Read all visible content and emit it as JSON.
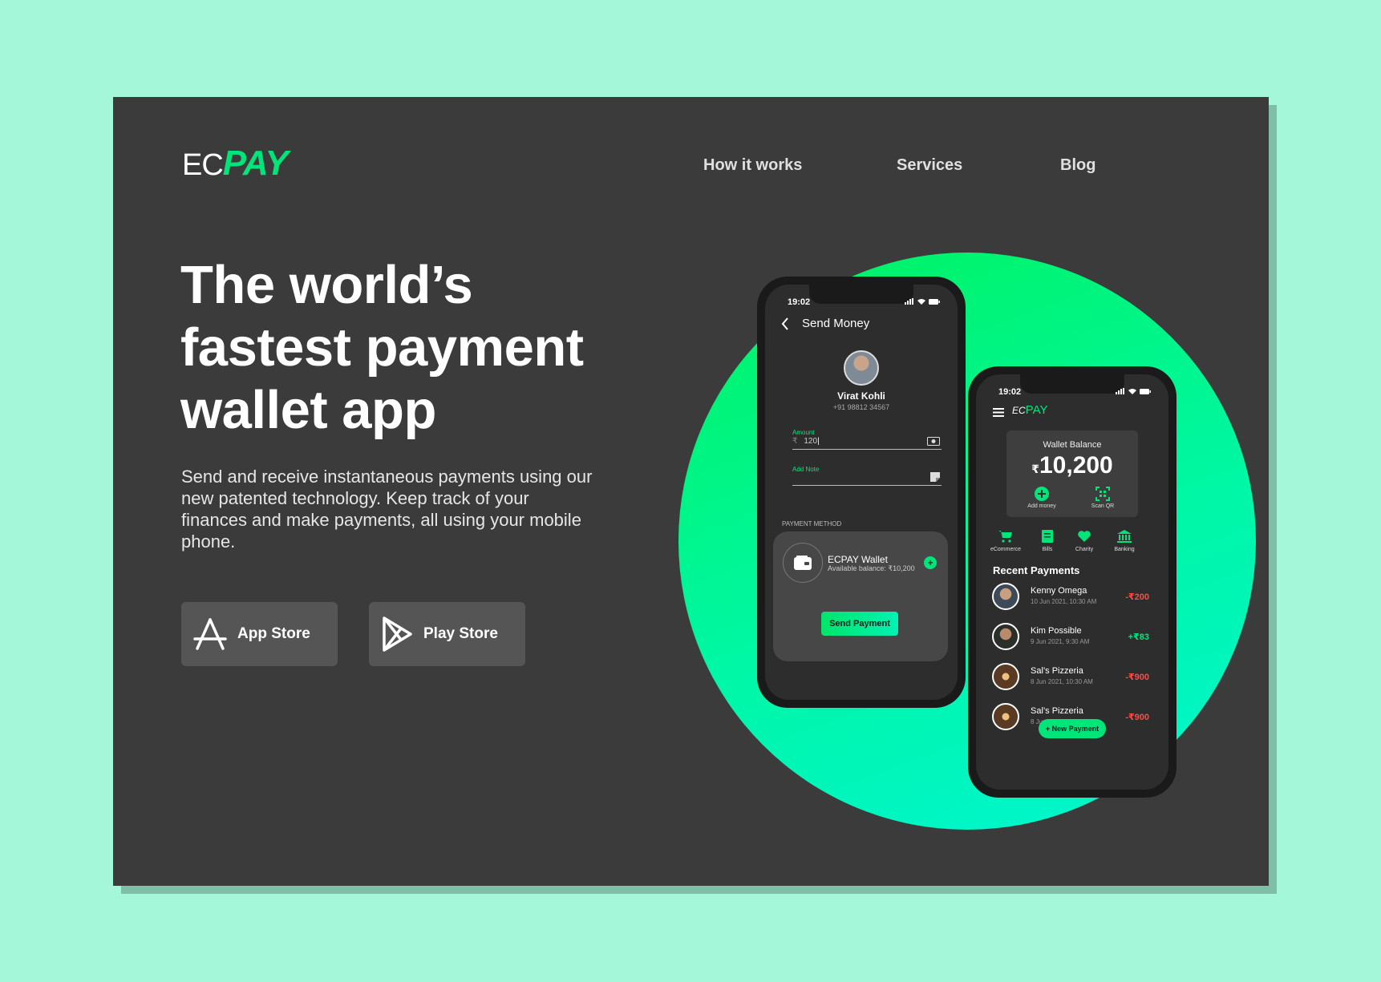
{
  "brand": {
    "ec": "EC",
    "pay": "PAY",
    "accent": "#00e57a"
  },
  "nav": {
    "how": "How it works",
    "services": "Services",
    "blog": "Blog"
  },
  "hero": {
    "title_lines": [
      "The world’s",
      "fastest payment",
      "wallet app"
    ],
    "subtitle": "Send and receive instantaneous payments using our new patented technology. Keep track of your finances and make payments, all using your mobile phone."
  },
  "stores": {
    "app": "App Store",
    "play": "Play Store"
  },
  "phone1": {
    "time": "19:02",
    "title": "Send Money",
    "contact_name": "Virat Kohli",
    "contact_phone": "+91 98812 34567",
    "amount_label": "Amount",
    "currency": "₹",
    "amount_value": "120",
    "note_label": "Add Note",
    "section": "PAYMENT METHOD",
    "wallet_name": "ECPAY Wallet",
    "wallet_balance": "Available balance: ₹10,200",
    "send_label": "Send Payment"
  },
  "phone2": {
    "time": "19:02",
    "logo_ec": "EC",
    "logo_pay": "PAY",
    "wallet_label": "Wallet Balance",
    "currency": "₹",
    "balance": "10,200",
    "actions": [
      "Add money",
      "Scan QR"
    ],
    "categories": [
      "eCommerce",
      "Bills",
      "Charity",
      "Banking"
    ],
    "recent_title": "Recent Payments",
    "transactions": [
      {
        "name": "Kenny Omega",
        "date": "10 Jun 2021, 10:30 AM",
        "amount": "-₹200"
      },
      {
        "name": "Kim Possible",
        "date": "9 Jun 2021, 9:30 AM",
        "amount": "+₹83"
      },
      {
        "name": "Sal’s Pizzeria",
        "date": "8 Jun 2021, 10:30 AM",
        "amount": "-₹900"
      },
      {
        "name": "Sal’s Pizzeria",
        "date": "8 Jun 2021, 10:30 AM",
        "amount": "-₹900"
      }
    ],
    "new_payment": "+ New Payment"
  }
}
